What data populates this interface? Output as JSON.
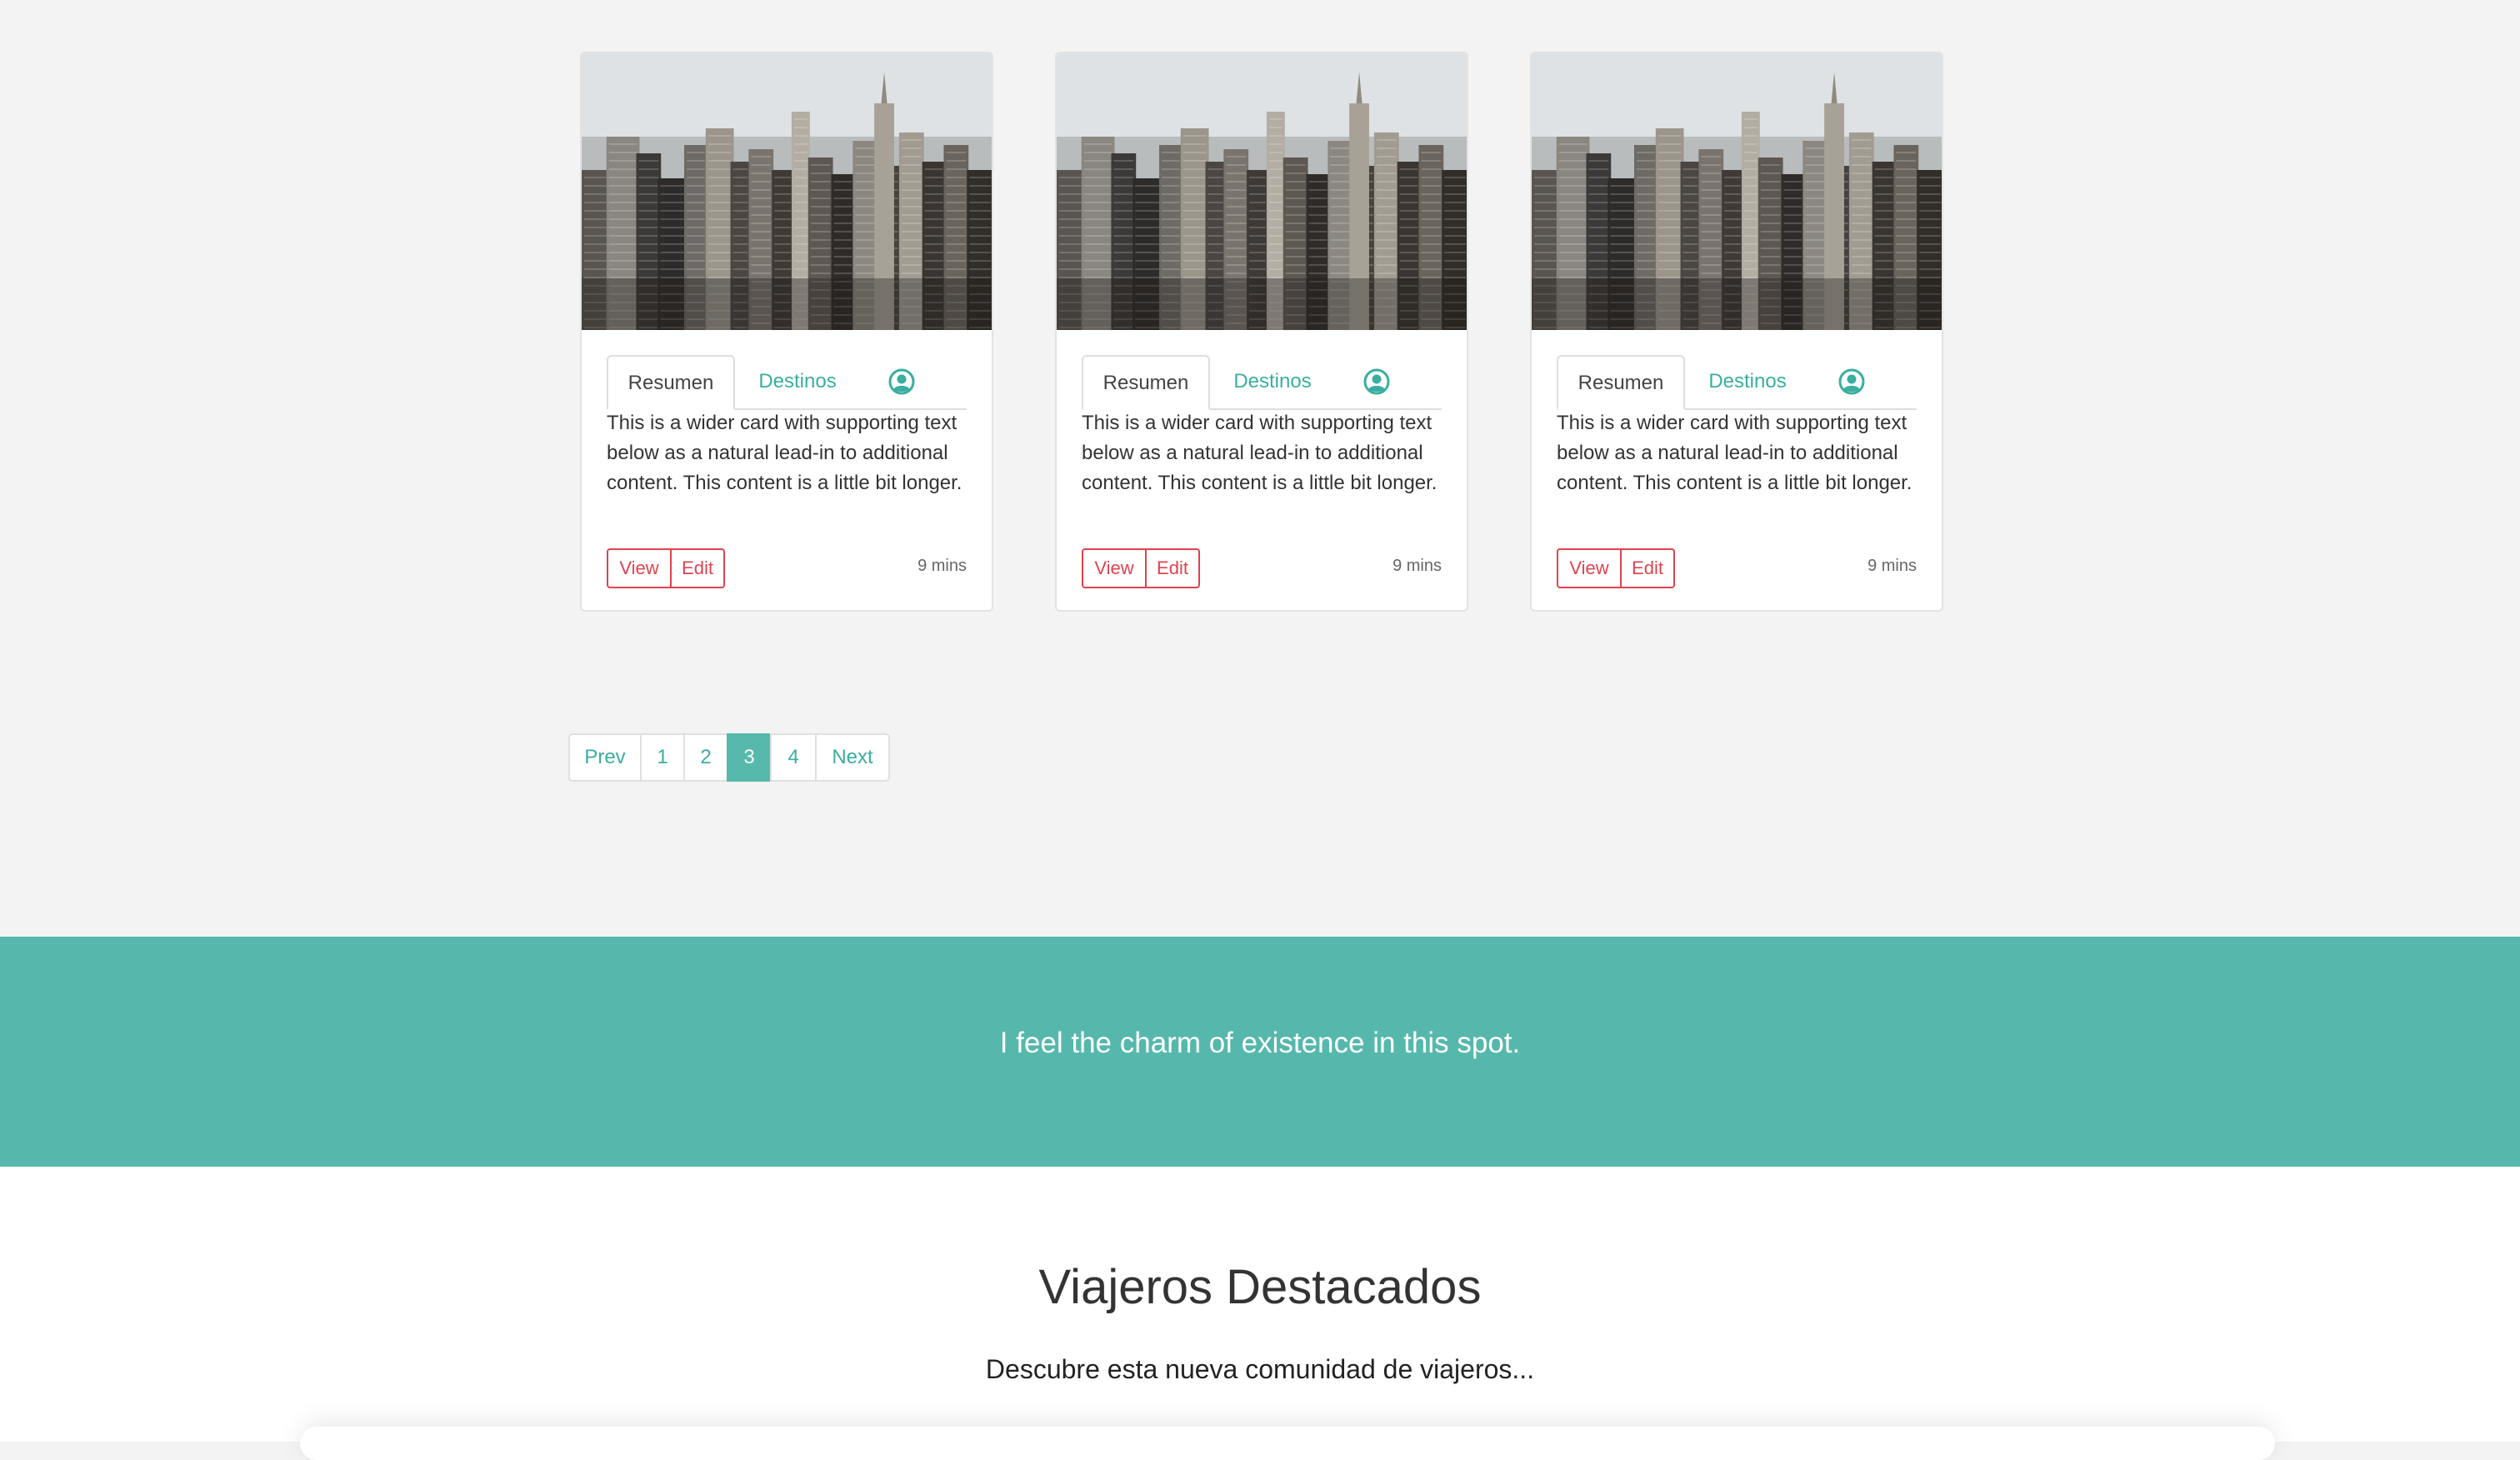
{
  "colors": {
    "accent": "#56b8ac",
    "link": "#3aaea0",
    "danger": "#e0434f",
    "background": "#f3f3f3"
  },
  "cards": [
    {
      "image_icon": "city-skyline-photo",
      "tab_summary": "Resumen",
      "tab_destinations": "Destinos",
      "tab_user_icon": "user-circle-icon",
      "text": "This is a wider card with supporting text below as a natural lead-in to additional content. This content is a little bit longer.",
      "view_label": "View",
      "edit_label": "Edit",
      "time": "9 mins"
    },
    {
      "image_icon": "city-skyline-photo",
      "tab_summary": "Resumen",
      "tab_destinations": "Destinos",
      "tab_user_icon": "user-circle-icon",
      "text": "This is a wider card with supporting text below as a natural lead-in to additional content. This content is a little bit longer.",
      "view_label": "View",
      "edit_label": "Edit",
      "time": "9 mins"
    },
    {
      "image_icon": "city-skyline-photo",
      "tab_summary": "Resumen",
      "tab_destinations": "Destinos",
      "tab_user_icon": "user-circle-icon",
      "text": "This is a wider card with supporting text below as a natural lead-in to additional content. This content is a little bit longer.",
      "view_label": "View",
      "edit_label": "Edit",
      "time": "9 mins"
    }
  ],
  "pagination": {
    "prev": "Prev",
    "pages": [
      "1",
      "2",
      "3",
      "4"
    ],
    "current": "3",
    "next": "Next"
  },
  "banner": {
    "quote": "I feel the charm of existence in this spot."
  },
  "featured": {
    "title": "Viajeros Destacados",
    "subtitle": "Descubre esta nueva comunidad de viajeros..."
  }
}
